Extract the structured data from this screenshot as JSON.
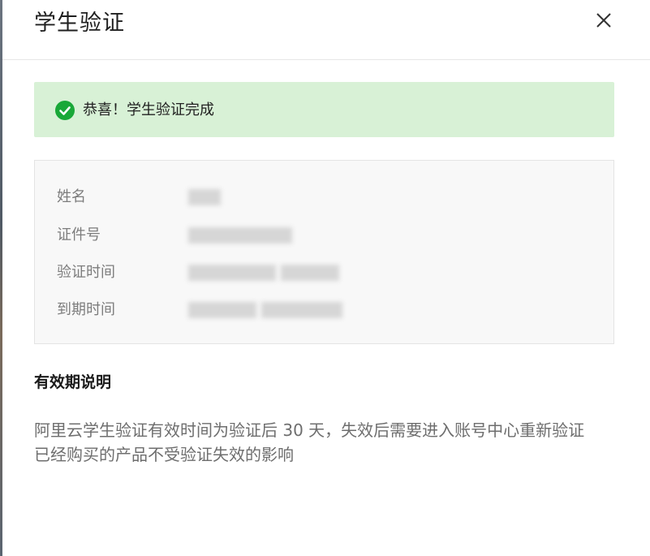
{
  "dialog": {
    "title": "学生验证",
    "close_icon": "close-icon"
  },
  "banner": {
    "icon": "check-circle-icon",
    "text": "恭喜！学生验证完成",
    "color": "#d8f1d6",
    "icon_color": "#19a838"
  },
  "info": {
    "rows": [
      {
        "label": "姓名",
        "value_redacted": true
      },
      {
        "label": "证件号",
        "value_redacted": true
      },
      {
        "label": "验证时间",
        "value_redacted": true
      },
      {
        "label": "到期时间",
        "value_redacted": true
      }
    ]
  },
  "validity": {
    "title": "有效期说明",
    "lines": [
      "阿里云学生验证有效时间为验证后 30 天，失效后需要进入账号中心重新验证",
      "已经购买的产品不受验证失效的影响"
    ]
  }
}
